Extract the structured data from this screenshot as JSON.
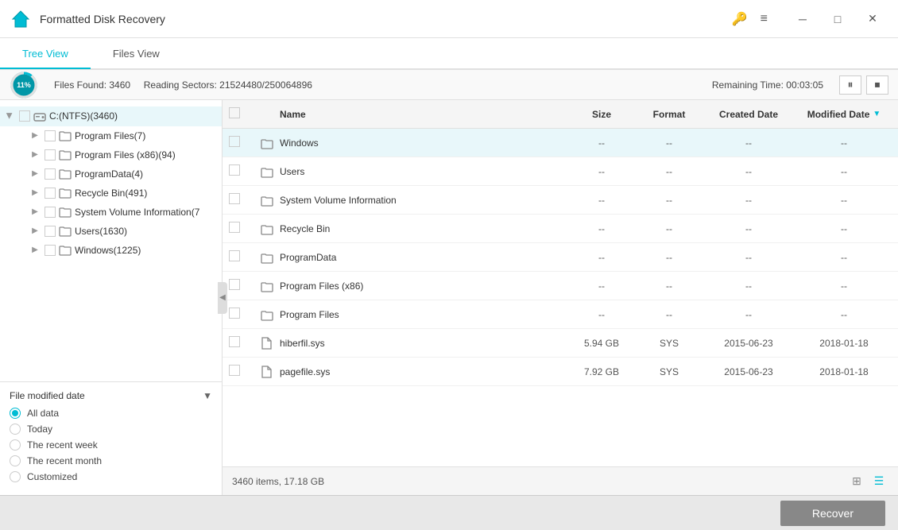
{
  "app": {
    "title": "Formatted Disk Recovery",
    "icon": "🏠"
  },
  "titlebar": {
    "controls": {
      "search_icon": "🔑",
      "menu_icon": "≡",
      "minimize": "─",
      "maximize": "□",
      "close": "✕"
    }
  },
  "tabs": [
    {
      "id": "tree",
      "label": "Tree View",
      "active": true
    },
    {
      "id": "files",
      "label": "Files View",
      "active": false
    }
  ],
  "statusbar": {
    "progress_pct": "11%",
    "files_found_label": "Files Found:",
    "files_found_value": "3460",
    "reading_sectors_label": "Reading Sectors:",
    "reading_sectors_value": "21524480/250064896",
    "remaining_label": "Remaining Time:",
    "remaining_value": "00:03:05"
  },
  "tree": {
    "root": {
      "label": "C:(NTFS)(3460)",
      "selected": true,
      "children": [
        {
          "label": "Program Files(7)",
          "children": []
        },
        {
          "label": "Program Files (x86)(94)",
          "children": []
        },
        {
          "label": "ProgramData(4)",
          "children": []
        },
        {
          "label": "Recycle Bin(491)",
          "children": []
        },
        {
          "label": "System Volume Information(7",
          "children": []
        },
        {
          "label": "Users(1630)",
          "children": []
        },
        {
          "label": "Windows(1225)",
          "children": []
        }
      ]
    }
  },
  "filter": {
    "title": "File modified date",
    "options": [
      {
        "label": "All data",
        "checked": true
      },
      {
        "label": "Today",
        "checked": false
      },
      {
        "label": "The recent week",
        "checked": false
      },
      {
        "label": "The recent month",
        "checked": false
      },
      {
        "label": "Customized",
        "checked": false
      }
    ]
  },
  "table": {
    "columns": [
      {
        "id": "name",
        "label": "Name"
      },
      {
        "id": "size",
        "label": "Size"
      },
      {
        "id": "format",
        "label": "Format"
      },
      {
        "id": "created",
        "label": "Created Date"
      },
      {
        "id": "modified",
        "label": "Modified Date",
        "sorted": true
      }
    ],
    "rows": [
      {
        "name": "Windows",
        "size": "--",
        "format": "--",
        "created": "--",
        "modified": "--",
        "is_folder": true,
        "highlighted": true
      },
      {
        "name": "Users",
        "size": "--",
        "format": "--",
        "created": "--",
        "modified": "--",
        "is_folder": true
      },
      {
        "name": "System Volume Information",
        "size": "--",
        "format": "--",
        "created": "--",
        "modified": "--",
        "is_folder": true
      },
      {
        "name": "Recycle Bin",
        "size": "--",
        "format": "--",
        "created": "--",
        "modified": "--",
        "is_folder": true
      },
      {
        "name": "ProgramData",
        "size": "--",
        "format": "--",
        "created": "--",
        "modified": "--",
        "is_folder": true
      },
      {
        "name": "Program Files (x86)",
        "size": "--",
        "format": "--",
        "created": "--",
        "modified": "--",
        "is_folder": true
      },
      {
        "name": "Program Files",
        "size": "--",
        "format": "--",
        "created": "--",
        "modified": "--",
        "is_folder": true
      },
      {
        "name": "hiberfil.sys",
        "size": "5.94 GB",
        "format": "SYS",
        "created": "2015-06-23",
        "modified": "2018-01-18",
        "is_folder": false
      },
      {
        "name": "pagefile.sys",
        "size": "7.92 GB",
        "format": "SYS",
        "created": "2015-06-23",
        "modified": "2018-01-18",
        "is_folder": false
      }
    ]
  },
  "bottom": {
    "info": "3460 items, 17.18 GB"
  },
  "recover": {
    "label": "Recover"
  }
}
